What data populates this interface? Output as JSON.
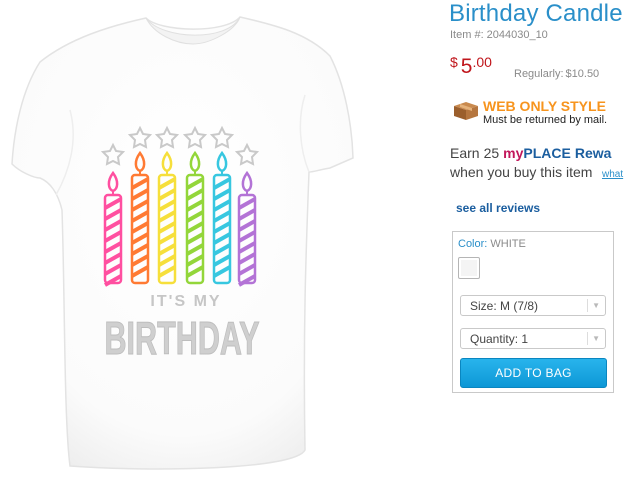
{
  "product": {
    "title": "Birthday Candle",
    "item_label": "Item #:",
    "item_number": "2044030_10",
    "price": {
      "currency": "$",
      "whole": "5",
      "cents": ".00"
    },
    "regular_label": "Regularly:",
    "regular_price": "$10.50",
    "web_only": {
      "title": "WEB ONLY STYLE",
      "note": "Must be returned by mail."
    },
    "rewards": {
      "earn_word": "Earn",
      "points": "25",
      "brand_my": "my",
      "brand_place": "PLACE",
      "reward_word": "Rewa",
      "line2": "when you buy this item",
      "whats_link": "what"
    },
    "reviews_link": "see all reviews"
  },
  "options": {
    "color_label": "Color:",
    "color_value": "WHITE",
    "swatch_color": "#ffffff",
    "size_text": "Size: M (7/8)",
    "quantity_text": "Quantity: 1",
    "add_button": "ADD TO BAG"
  },
  "shirt_graphic": {
    "line1": "IT'S MY",
    "line2": "BIRTHDAY",
    "candle_colors": [
      "#ff4fa0",
      "#ff7a33",
      "#f6df3b",
      "#93d63a",
      "#37c7e0",
      "#b373d6"
    ]
  },
  "colors": {
    "accent_blue": "#2a8fc9",
    "price_red": "#c0161c",
    "web_only_orange": "#f7941d",
    "button_blue": "#1ba7e4"
  }
}
